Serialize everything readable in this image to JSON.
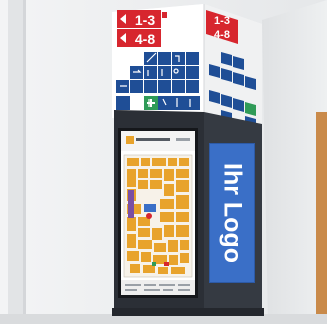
{
  "scene": {
    "description_tags": [
      "wayfinding-pylon",
      "digital-directory-kiosk",
      "corridor"
    ]
  },
  "sign_top": {
    "floor_labels_front": [
      "1-3",
      "4-8"
    ],
    "floor_labels_side": [
      "1-3",
      "4-8"
    ],
    "accent_color": "#d7262e",
    "pictogram_color": "#1f4e96",
    "pictograms": [
      "arrow-left-icon",
      "arrow-up-icon",
      "stairs-icon",
      "escalator-icon",
      "parking-icon",
      "wheelchair-icon",
      "information-icon",
      "toilet-icon",
      "elevator-icon",
      "first-aid-icon",
      "arrow-right-icon"
    ]
  },
  "screen": {
    "map_style": "floor-plan",
    "map_accent": "#e8a32c"
  },
  "side_panel": {
    "logo_text": "Ihr Logo",
    "color": "#3a6fc7"
  },
  "kiosk": {
    "body_color": "#2b2f36"
  }
}
